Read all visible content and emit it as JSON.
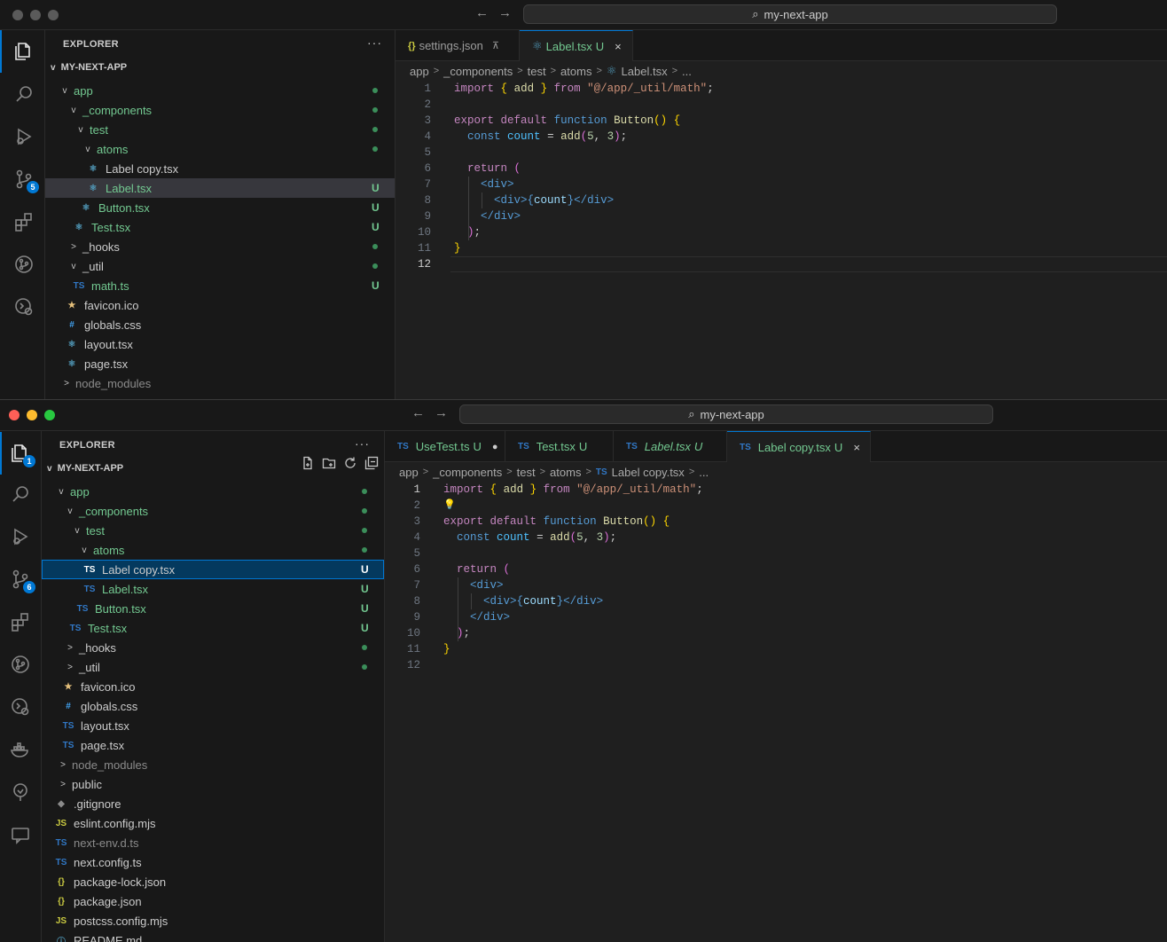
{
  "window_top": {
    "title": "my-next-app",
    "explorer_title": "EXPLORER",
    "root_label": "MY-NEXT-APP",
    "scm_badge": "5",
    "tree": [
      {
        "label": "app",
        "chev": "v",
        "status": "dot"
      },
      {
        "label": "_components",
        "chev": "v",
        "status": "dot"
      },
      {
        "label": "test",
        "chev": "v",
        "status": "dot"
      },
      {
        "label": "atoms",
        "chev": "v",
        "status": "dot"
      },
      {
        "label": "Label copy.tsx",
        "icon": "⚛",
        "status": ""
      },
      {
        "label": "Label.tsx",
        "icon": "⚛",
        "status": "U"
      },
      {
        "label": "Button.tsx",
        "icon": "⚛",
        "status": "U"
      },
      {
        "label": "Test.tsx",
        "icon": "⚛",
        "status": "U"
      },
      {
        "label": "_hooks",
        "chev": ">",
        "status": "dot"
      },
      {
        "label": "_util",
        "chev": "v",
        "status": "dot"
      },
      {
        "label": "math.ts",
        "icon": "TS",
        "status": "U"
      },
      {
        "label": "favicon.ico",
        "icon": "★",
        "status": ""
      },
      {
        "label": "globals.css",
        "icon": "#",
        "status": ""
      },
      {
        "label": "layout.tsx",
        "icon": "⚛",
        "status": ""
      },
      {
        "label": "page.tsx",
        "icon": "⚛",
        "status": ""
      },
      {
        "label": "node_modules",
        "chev": ">",
        "status": ""
      }
    ],
    "tabs": [
      {
        "label": "settings.json",
        "icon": "{}",
        "pin": "⊼"
      },
      {
        "label": "Label.tsx",
        "icon": "⚛",
        "status": "U",
        "close": "×"
      }
    ],
    "breadcrumb": [
      "app",
      "_components",
      "test",
      "atoms",
      "Label.tsx",
      "..."
    ],
    "line_numbers": [
      "1",
      "2",
      "3",
      "4",
      "5",
      "6",
      "7",
      "8",
      "9",
      "10",
      "11",
      "12"
    ]
  },
  "window_bottom": {
    "title": "my-next-app",
    "explorer_title": "EXPLORER",
    "root_label": "MY-NEXT-APP",
    "explorer_badge": "1",
    "scm_badge": "6",
    "tree": [
      {
        "label": "app",
        "chev": "v",
        "status": "dot"
      },
      {
        "label": "_components",
        "chev": "v",
        "status": "dot"
      },
      {
        "label": "test",
        "chev": "v",
        "status": "dot"
      },
      {
        "label": "atoms",
        "chev": "v",
        "status": "dot"
      },
      {
        "label": "Label copy.tsx",
        "icon": "TS",
        "status": "U"
      },
      {
        "label": "Label.tsx",
        "icon": "TS",
        "status": "U"
      },
      {
        "label": "Button.tsx",
        "icon": "TS",
        "status": "U"
      },
      {
        "label": "Test.tsx",
        "icon": "TS",
        "status": "U"
      },
      {
        "label": "_hooks",
        "chev": ">",
        "status": "dot"
      },
      {
        "label": "_util",
        "chev": ">",
        "status": "dot"
      },
      {
        "label": "favicon.ico",
        "icon": "★",
        "status": ""
      },
      {
        "label": "globals.css",
        "icon": "#",
        "status": ""
      },
      {
        "label": "layout.tsx",
        "icon": "TS",
        "status": ""
      },
      {
        "label": "page.tsx",
        "icon": "TS",
        "status": ""
      },
      {
        "label": "node_modules",
        "chev": ">",
        "status": ""
      },
      {
        "label": "public",
        "chev": ">",
        "status": ""
      },
      {
        "label": ".gitignore",
        "icon": "◆",
        "status": ""
      },
      {
        "label": "eslint.config.mjs",
        "icon": "JS",
        "status": ""
      },
      {
        "label": "next-env.d.ts",
        "icon": "TS",
        "status": ""
      },
      {
        "label": "next.config.ts",
        "icon": "TS",
        "status": ""
      },
      {
        "label": "package-lock.json",
        "icon": "{}",
        "status": ""
      },
      {
        "label": "package.json",
        "icon": "{}",
        "status": ""
      },
      {
        "label": "postcss.config.mjs",
        "icon": "JS",
        "status": ""
      },
      {
        "label": "README.md",
        "icon": "ⓘ",
        "status": ""
      }
    ],
    "tabs": [
      {
        "label": "UseTest.ts",
        "icon": "TS",
        "status": "U",
        "dirty": "●"
      },
      {
        "label": "Test.tsx",
        "icon": "TS",
        "status": "U"
      },
      {
        "label": "Label.tsx",
        "icon": "TS",
        "status": "U"
      },
      {
        "label": "Label copy.tsx",
        "icon": "TS",
        "status": "U",
        "close": "×"
      }
    ],
    "breadcrumb": [
      "app",
      "_components",
      "test",
      "atoms",
      "Label copy.tsx",
      "..."
    ],
    "line_numbers": [
      "1",
      "2",
      "3",
      "4",
      "5",
      "6",
      "7",
      "8",
      "9",
      "10",
      "11",
      "12"
    ]
  },
  "code_lines": [
    [
      [
        "kw",
        "import"
      ],
      [
        "p",
        " "
      ],
      [
        "br1",
        "{"
      ],
      [
        "p",
        " "
      ],
      [
        "fn",
        "add"
      ],
      [
        "p",
        " "
      ],
      [
        "br1",
        "}"
      ],
      [
        "p",
        " "
      ],
      [
        "kw",
        "from"
      ],
      [
        "p",
        " "
      ],
      [
        "st",
        "\"@/app/_util/math\""
      ],
      [
        "p",
        ";"
      ]
    ],
    [],
    [
      [
        "kw",
        "export"
      ],
      [
        "p",
        " "
      ],
      [
        "kw",
        "default"
      ],
      [
        "p",
        " "
      ],
      [
        "kb",
        "function"
      ],
      [
        "p",
        " "
      ],
      [
        "fn",
        "Button"
      ],
      [
        "br1",
        "()"
      ],
      [
        "p",
        " "
      ],
      [
        "br1",
        "{"
      ]
    ],
    [
      [
        "p",
        "  "
      ],
      [
        "kb",
        "const"
      ],
      [
        "p",
        " "
      ],
      [
        "cn",
        "count"
      ],
      [
        "p",
        " = "
      ],
      [
        "fn",
        "add"
      ],
      [
        "br2",
        "("
      ],
      [
        "nm",
        "5"
      ],
      [
        "p",
        ", "
      ],
      [
        "nm",
        "3"
      ],
      [
        "br2",
        ")"
      ],
      [
        "p",
        ";"
      ]
    ],
    [],
    [
      [
        "p",
        "  "
      ],
      [
        "kw",
        "return"
      ],
      [
        "p",
        " "
      ],
      [
        "br2",
        "("
      ]
    ],
    [
      [
        "p",
        "    "
      ],
      [
        "tg",
        "<div>"
      ]
    ],
    [
      [
        "p",
        "      "
      ],
      [
        "tg",
        "<div>"
      ],
      [
        "kb",
        "{"
      ],
      [
        "vr",
        "count"
      ],
      [
        "kb",
        "}"
      ],
      [
        "tg",
        "</div>"
      ]
    ],
    [
      [
        "p",
        "    "
      ],
      [
        "tg",
        "</div>"
      ]
    ],
    [
      [
        "p",
        "  "
      ],
      [
        "br2",
        ")"
      ],
      [
        "p",
        ";"
      ]
    ],
    [
      [
        "br1",
        "}"
      ]
    ],
    []
  ],
  "colors": {
    "accent": "#0078d4",
    "untracked": "#73c991",
    "selection": "#04395e"
  }
}
